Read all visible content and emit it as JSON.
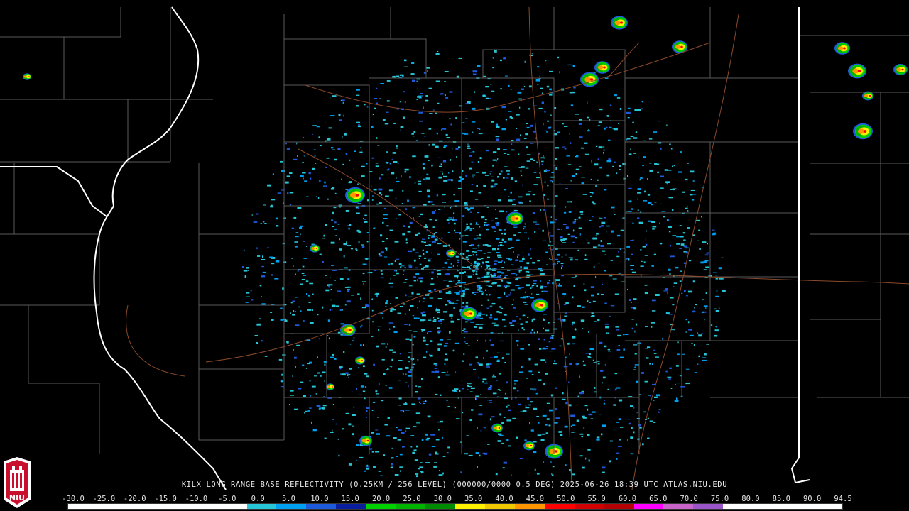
{
  "caption": "KILX LONG RANGE BASE REFLECTIVITY (0.25KM / 256 LEVEL) (000000/0000 0.5 DEG) 2025-06-26 18:39 UTC  ATLAS.NIU.EDU",
  "logo": {
    "name": "niu-logo",
    "text": "NIU"
  },
  "scale": {
    "labels": [
      "-30.0",
      "-25.0",
      "-20.0",
      "-15.0",
      "-10.0",
      "-5.0",
      "0.0",
      "5.0",
      "10.0",
      "15.0",
      "20.0",
      "25.0",
      "30.0",
      "35.0",
      "40.0",
      "45.0",
      "50.0",
      "55.0",
      "60.0",
      "65.0",
      "70.0",
      "75.0",
      "80.0",
      "85.0",
      "90.0",
      "94.5"
    ],
    "colors": [
      "#ffffff",
      "#ffffff",
      "#ffffff",
      "#ffffff",
      "#ffffff",
      "#ffffff",
      "#27c6d6",
      "#00a0f0",
      "#1e5adc",
      "#0a1fa0",
      "#00d200",
      "#00b400",
      "#008c00",
      "#fff000",
      "#f0c800",
      "#ff9600",
      "#ff0000",
      "#d20000",
      "#b40000",
      "#ff00ff",
      "#c864c8",
      "#9a56c8",
      "#ffffff",
      "#ffffff",
      "#ffffff",
      "#ffffff"
    ]
  },
  "colors": {
    "background": "#000000",
    "county_lines": "#5a5a5a",
    "state_lines": "#ffffff",
    "highways": "#8b4a2b"
  }
}
